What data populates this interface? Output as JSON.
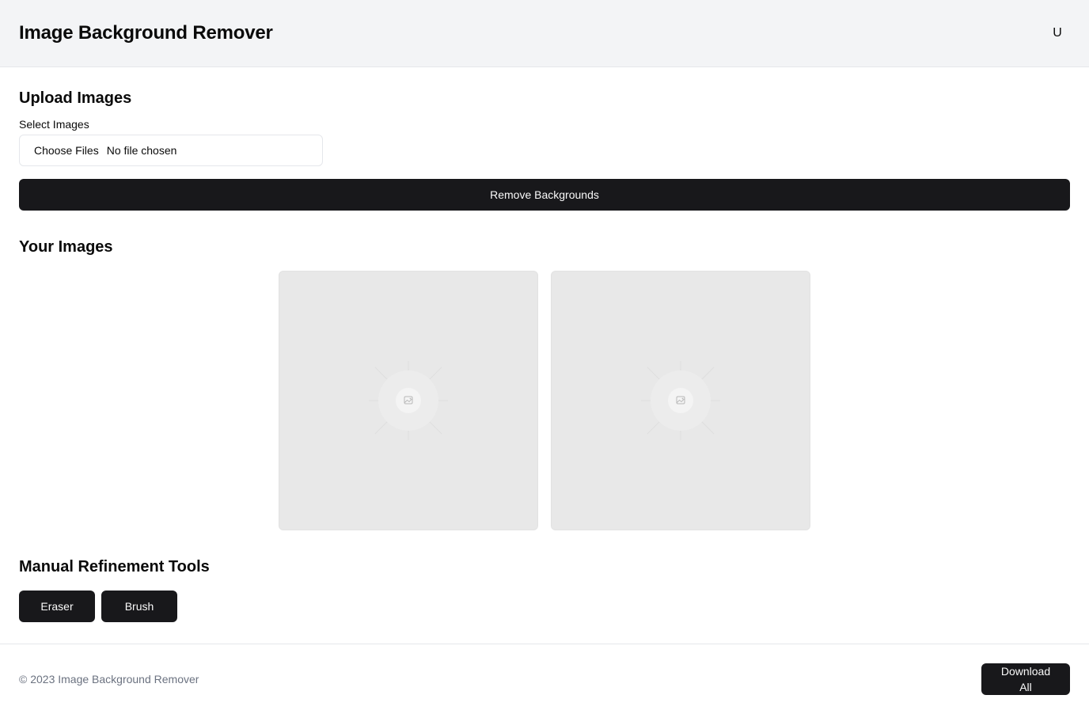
{
  "header": {
    "title": "Image Background Remover",
    "avatar_initial": "U"
  },
  "upload": {
    "title": "Upload Images",
    "field_label": "Select Images",
    "choose_button": "Choose Files",
    "file_status": "No file chosen",
    "submit_label": "Remove Backgrounds"
  },
  "images": {
    "title": "Your Images",
    "cards": [
      {
        "icon": "image-placeholder-icon"
      },
      {
        "icon": "image-placeholder-icon"
      }
    ]
  },
  "tools": {
    "title": "Manual Refinement Tools",
    "buttons": [
      "Eraser",
      "Brush"
    ]
  },
  "footer": {
    "copyright": "© 2023 Image Background Remover",
    "download_label": "Download All"
  },
  "colors": {
    "header_bg": "#f3f4f6",
    "primary": "#18181b",
    "primary_text": "#fafafa",
    "card_bg": "#e8e8e8",
    "muted_text": "#6b7280"
  }
}
